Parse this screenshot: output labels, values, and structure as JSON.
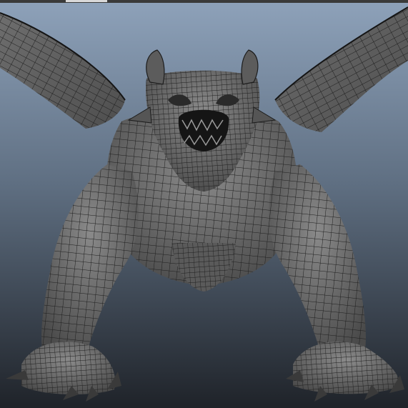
{
  "viewport": {
    "background_top_color": "#8a9db5",
    "background_bottom_color": "#23272d",
    "mesh_fill_color": "#6b6b6b",
    "mesh_wire_color": "#1c1c1c",
    "topbar_color": "#3a3a3a",
    "topbar_highlight_color": "#d9d9d9"
  },
  "model": {
    "subject": "dragon-wireframe-model",
    "display_mode": "wireframe-on-shaded"
  }
}
